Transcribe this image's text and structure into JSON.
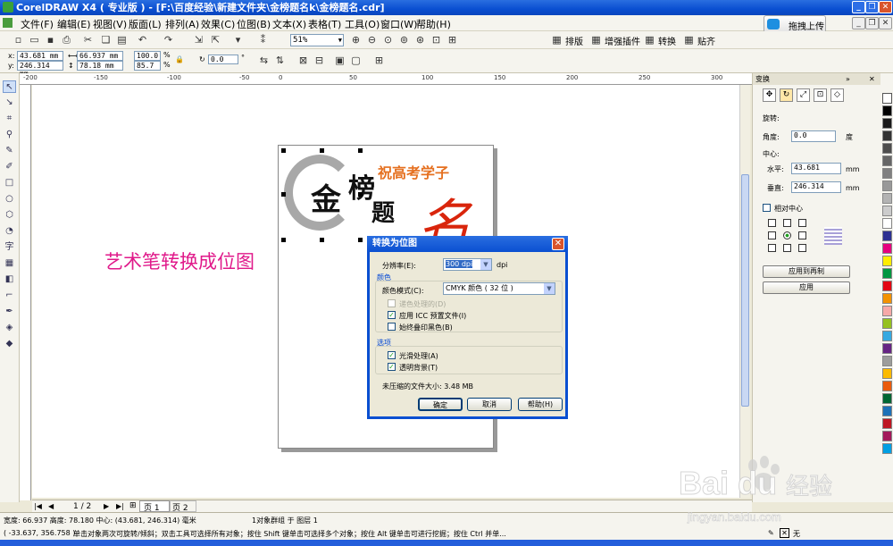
{
  "window": {
    "title": "CorelDRAW X4 ( 专业版 ) - [F:\\百度经验\\新建文件夹\\金榜题名k\\金榜题名.cdr]"
  },
  "menu": [
    "文件(F)",
    "编辑(E)",
    "视图(V)",
    "版面(L)",
    "排列(A)",
    "效果(C)",
    "位图(B)",
    "文本(X)",
    "表格(T)",
    "工具(O)",
    "窗口(W)",
    "帮助(H)"
  ],
  "upload_button": "拖拽上传",
  "toolbar1": {
    "zoom": "51%",
    "plugins": [
      "排版",
      "增强插件",
      "转换",
      "贴齐"
    ]
  },
  "toolbar2": {
    "x": "43.681 mm",
    "y": "246.314 mm",
    "width": "66.937 mm",
    "height": "78.18 mm",
    "scale_x": "100.0",
    "scale_y": "85.7",
    "percent": "%",
    "rotation": "0.0",
    "degree": "°"
  },
  "canvas": {
    "annotation": "艺术笔转换成位图",
    "artwork": {
      "char1": "金",
      "char2": "榜",
      "char3": "题",
      "char4": "名",
      "slogan": "祝高考学子"
    }
  },
  "dialog": {
    "title": "转换为位图",
    "resolution_label": "分辨率(E):",
    "resolution_value": "300 dpi",
    "resolution_unit": "dpi",
    "color_section": "颜色",
    "color_mode_label": "颜色模式(C):",
    "color_mode_value": "CMYK 颜色 ( 32 位 )",
    "dithered_label": "递色处理的(D)",
    "apply_icc_label": "应用 ICC 预置文件(I)",
    "always_overprint_label": "始终叠印黑色(B)",
    "options_section": "选项",
    "anti_alias_label": "光滑处理(A)",
    "transparent_bg_label": "透明背景(T)",
    "file_size_label": "未压缩的文件大小: 3.48 MB",
    "ok": "确定",
    "cancel": "取消",
    "help": "帮助(H)"
  },
  "docker": {
    "title": "变换",
    "rotate_label": "旋转:",
    "angle_label": "角度:",
    "angle_value": "0.0",
    "angle_unit": "度",
    "center_label": "中心:",
    "horizontal_label": "水平:",
    "horizontal_value": "43.681",
    "vertical_label": "垂直:",
    "vertical_value": "246.314",
    "unit": "mm",
    "relative_center_label": "相对中心",
    "apply_copy": "应用到再制",
    "apply": "应用"
  },
  "pagebar": {
    "page_counter": "1 / 2",
    "tab1": "页 1",
    "tab2": "页 2"
  },
  "status": {
    "line1": "宽度: 66.937 高度: 78.180 中心: (43.681, 246.314) 毫米",
    "selection": "1对象群组 于 图层 1",
    "line2": "( -33.637, 356.758 )",
    "hint": "单击对象两次可旋转/倾斜；双击工具可选择所有对象；按住 Shift 键单击可选择多个对象；按住 Alt 键单击可进行挖掘；按住 Ctrl 并单...",
    "fill_none": "无"
  },
  "colors": {
    "titlebar": "#0a4fd1",
    "annotation": "#e0198a",
    "accent_red": "#d9250c",
    "slogan_orange": "#e57020"
  },
  "watermark": {
    "brand": "Bai",
    "brand2": "du",
    "cn": "经验",
    "url": "jingyan.baidu.com"
  }
}
